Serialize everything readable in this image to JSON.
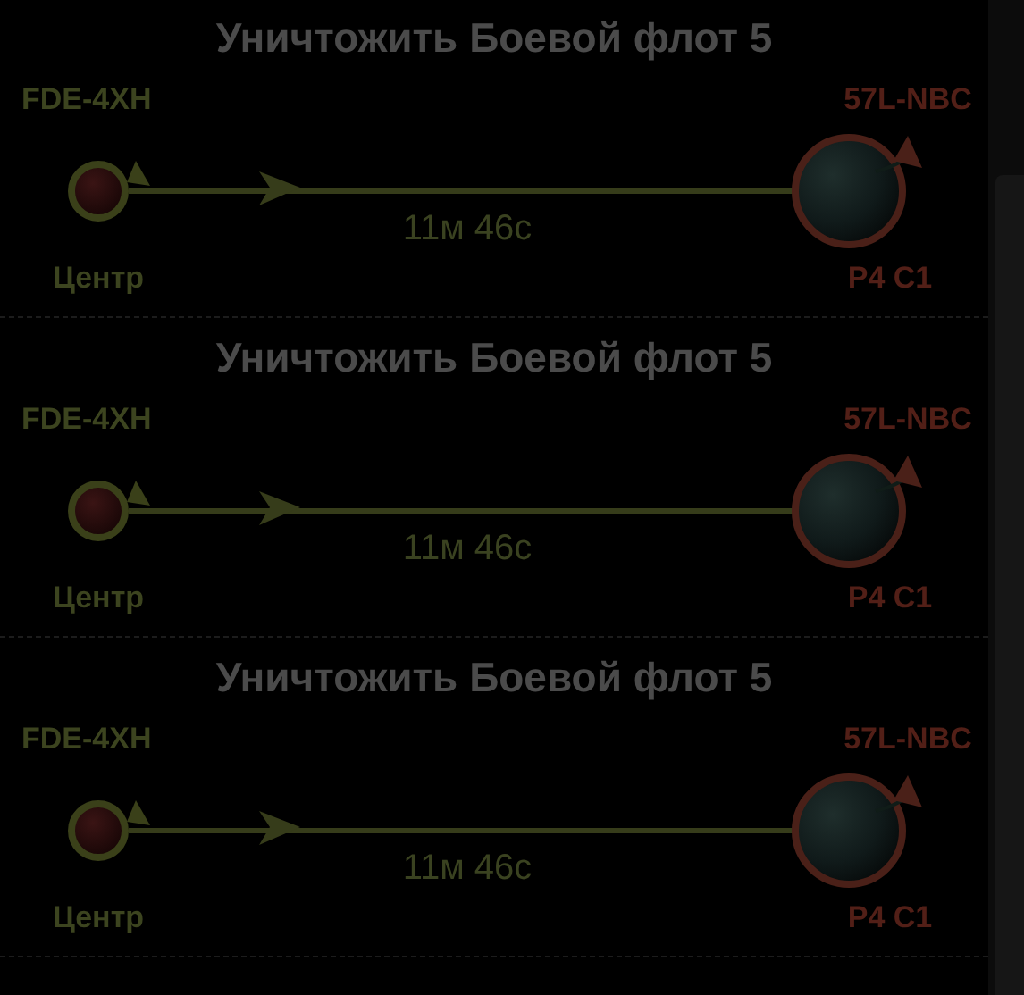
{
  "routes": [
    {
      "title": "Уничтожить Боевой флот 5",
      "origin": {
        "system": "FDE-4XH",
        "name": "Центр"
      },
      "destination": {
        "system": "57L-NBC",
        "name": "P4 C1"
      },
      "duration": "11м 46с"
    },
    {
      "title": "Уничтожить Боевой флот 5",
      "origin": {
        "system": "FDE-4XH",
        "name": "Центр"
      },
      "destination": {
        "system": "57L-NBC",
        "name": "P4 C1"
      },
      "duration": "11м 46с"
    },
    {
      "title": "Уничтожить Боевой флот 5",
      "origin": {
        "system": "FDE-4XH",
        "name": "Центр"
      },
      "destination": {
        "system": "57L-NBC",
        "name": "P4 C1"
      },
      "duration": "11м 46с"
    }
  ]
}
